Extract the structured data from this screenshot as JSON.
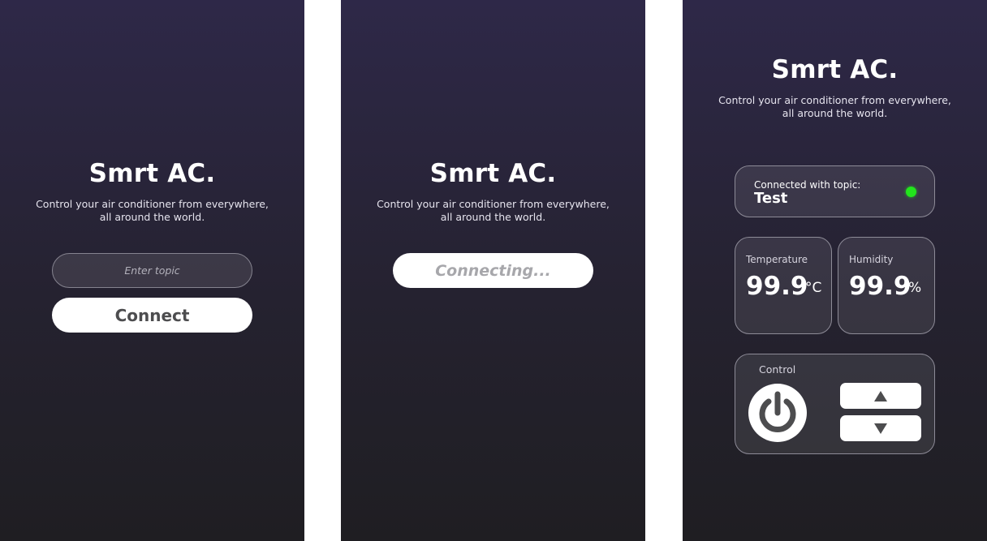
{
  "app": {
    "title": "Smrt AC.",
    "subtitle": "Control your air conditioner from everywhere,\nall around the world."
  },
  "screen1": {
    "topic_placeholder": "Enter topic",
    "connect_label": "Connect"
  },
  "screen2": {
    "connecting_label": "Connecting..."
  },
  "screen3": {
    "connection": {
      "label": "Connected with topic:",
      "topic": "Test",
      "status_color": "#22e51c"
    },
    "temperature": {
      "label": "Temperature",
      "value": "99.9",
      "unit": "°C"
    },
    "humidity": {
      "label": "Humidity",
      "value": "99.9",
      "unit": "%"
    },
    "control": {
      "label": "Control",
      "power_icon": "power-icon",
      "up_icon": "triangle-up-icon",
      "down_icon": "triangle-down-icon"
    }
  },
  "colors": {
    "bg_top": "#2e2848",
    "bg_bottom": "#1f1e22",
    "status_connected": "#22e51c",
    "button_text": "#4d4d4f"
  }
}
